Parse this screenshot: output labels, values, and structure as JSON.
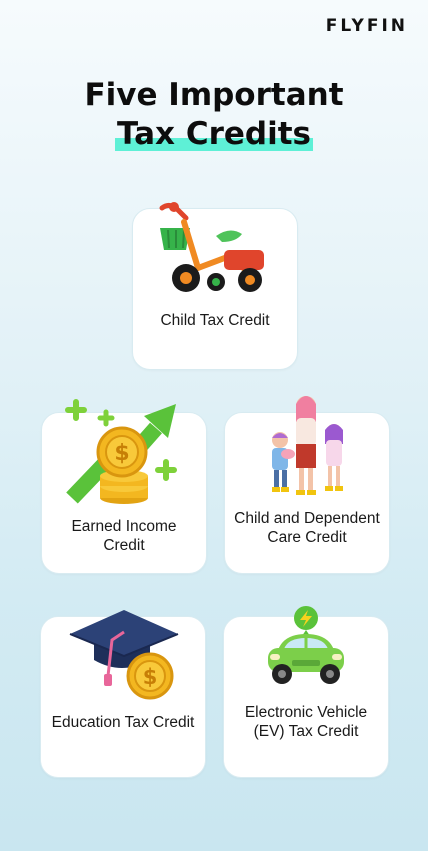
{
  "brand": {
    "logo": "FLYFIN"
  },
  "header": {
    "title_line1": "Five Important",
    "title_line2": "Tax Credits"
  },
  "cards": [
    {
      "label": "Child Tax Credit",
      "icon": "tricycle-icon"
    },
    {
      "label": "Earned Income Credit",
      "icon": "coin-growth-icon"
    },
    {
      "label": "Child and Dependent Care Credit",
      "icon": "family-icon"
    },
    {
      "label": "Education Tax Credit",
      "icon": "graduation-cap-icon"
    },
    {
      "label": "Electronic Vehicle (EV) Tax Credit",
      "icon": "electric-car-icon"
    }
  ],
  "colors": {
    "highlight": "#5ef0d6",
    "background": "#d3ebf3"
  }
}
